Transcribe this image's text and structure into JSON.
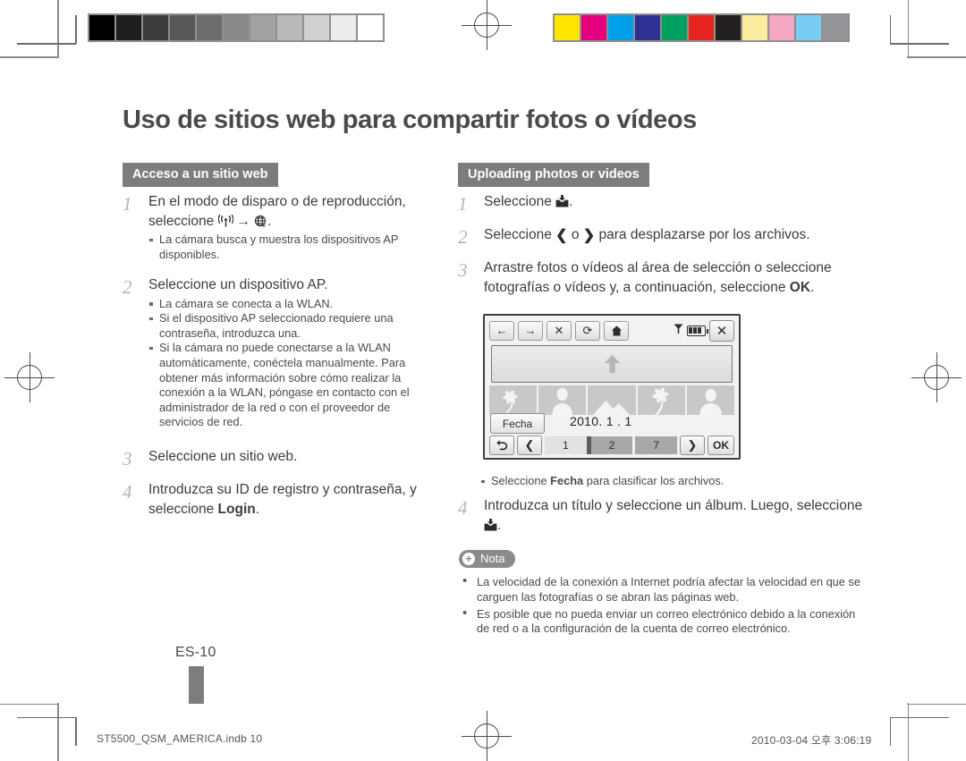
{
  "document": {
    "title": "Uso de sitios web para compartir fotos o vídeos",
    "page_number": "ES-10",
    "footer_file": "ST5500_QSM_AMERICA.indb   10",
    "footer_timestamp": "2010-03-04   오후 3:06:19"
  },
  "calibration": {
    "grayscale": [
      "#000000",
      "#1f1f1f",
      "#3b3b3b",
      "#575757",
      "#6d6d6d",
      "#888888",
      "#a2a2a2",
      "#b9b9b9",
      "#d0d0d0",
      "#ececec",
      "#ffffff"
    ],
    "colors": [
      "#ffe500",
      "#e5007e",
      "#00a0e9",
      "#2e3192",
      "#00a160",
      "#e52420",
      "#231f20",
      "#faeda0",
      "#f4a7c3",
      "#79cdf2",
      "#939598"
    ]
  },
  "left_column": {
    "section_label": "Acceso a un sitio web",
    "steps": [
      {
        "num": "1",
        "text_before": "En el modo de disparo o de reproducción, seleccione ",
        "icon1": "wifi-icon",
        "arrow": "→",
        "icon2": "globe-icon",
        "text_after": ".",
        "subs": [
          "La cámara busca y muestra los dispositivos AP disponibles."
        ]
      },
      {
        "num": "2",
        "text": "Seleccione un dispositivo AP.",
        "subs": [
          "La cámara se conecta a la WLAN.",
          "Si el dispositivo AP seleccionado requiere una contraseña, introduzca una.",
          "Si la cámara no puede conectarse a la WLAN automáticamente, conéctela manualmente. Para obtener más información sobre cómo realizar la conexión a la WLAN, póngase en contacto con el administrador de la red o con el proveedor de servicios de red."
        ]
      },
      {
        "num": "3",
        "text": "Seleccione un sitio web.",
        "subs": []
      },
      {
        "num": "4",
        "text_before": "Introduzca su ID de registro y contraseña, y seleccione ",
        "bold": "Login",
        "text_after": ".",
        "subs": []
      }
    ]
  },
  "right_column": {
    "section_label": "Uploading photos or videos",
    "steps": [
      {
        "num": "1",
        "text_before": "Seleccione ",
        "icon": "upload-icon",
        "text_after": "."
      },
      {
        "num": "2",
        "text_before": "Seleccione ",
        "chev_left": "❮",
        "mid": " o ",
        "chev_right": "❯",
        "text_after": " para desplazarse por los archivos."
      },
      {
        "num": "3",
        "text_before": "Arrastre fotos o vídeos al área de selección o seleccione fotografías o vídeos y, a continuación, seleccione ",
        "bold": "OK",
        "text_after": "."
      }
    ],
    "camera_note_before": "Seleccione ",
    "camera_note_bold": "Fecha",
    "camera_note_after": " para clasificar los archivos.",
    "step4": {
      "num": "4",
      "text_before": "Introduzca un título y seleccione un álbum. Luego, seleccione ",
      "icon": "upload-icon",
      "text_after": "."
    },
    "note": {
      "label": "Nota",
      "items": [
        "La velocidad de la conexión a Internet podría afectar la velocidad en que se carguen las fotografías o se abran las páginas web.",
        "Es posible que no pueda enviar un correo electrónico debido a la conexión de red o a la configuración de la cuenta de correo electrónico."
      ]
    }
  },
  "camera_screen": {
    "toolbar": [
      {
        "name": "back-arrow-button",
        "glyph": "←"
      },
      {
        "name": "forward-arrow-button",
        "glyph": "→"
      },
      {
        "name": "stop-button",
        "glyph": "✕"
      },
      {
        "name": "refresh-button",
        "glyph": "⟳"
      },
      {
        "name": "home-button",
        "glyph": "⌂"
      }
    ],
    "signal_icon": "signal-icon",
    "battery_icon": "battery-icon",
    "close_button": "✕",
    "drop_area_icon": "upload-arrow-icon",
    "thumbnails": [
      "flower",
      "portrait",
      "landscape",
      "palm",
      "portrait"
    ],
    "date_button": "Fecha",
    "date_value": "2010. 1 . 1",
    "nav": {
      "undo": "↰",
      "prev": "❮",
      "next": "❯",
      "ok": "OK"
    },
    "slider_values": [
      "1",
      "2",
      "7"
    ]
  }
}
